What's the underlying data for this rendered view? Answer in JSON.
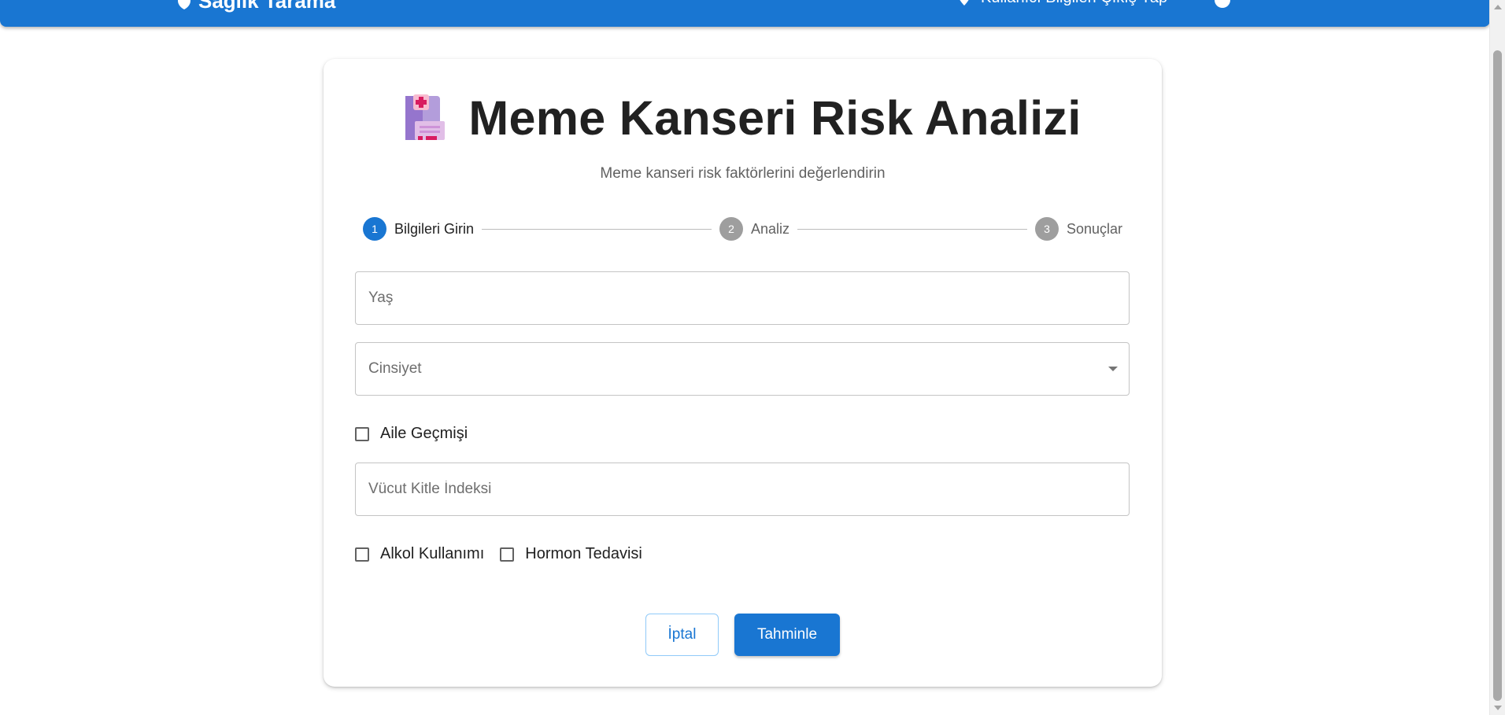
{
  "appbar": {
    "brand": "Sağlık Tarama",
    "right_text": "Kullanıcı Bilgileri Çıkış Yap"
  },
  "page": {
    "title": "Meme Kanseri Risk Analizi",
    "title_icon": "hospital-icon",
    "subtitle": "Meme kanseri risk faktörlerini değerlendirin"
  },
  "stepper": {
    "steps": [
      {
        "num": "1",
        "label": "Bilgileri Girin"
      },
      {
        "num": "2",
        "label": "Analiz"
      },
      {
        "num": "3",
        "label": "Sonuçlar"
      }
    ],
    "active_index": 0
  },
  "form": {
    "age_placeholder": "Yaş",
    "gender_label": "Cinsiyet",
    "family_history_label": "Aile Geçmişi",
    "bmi_placeholder": "Vücut Kitle İndeksi",
    "alcohol_label": "Alkol Kullanımı",
    "hormone_label": "Hormon Tedavisi"
  },
  "buttons": {
    "cancel": "İptal",
    "submit": "Tahminle"
  },
  "colors": {
    "primary": "#1976d2",
    "inactive_step": "#9e9e9e"
  }
}
